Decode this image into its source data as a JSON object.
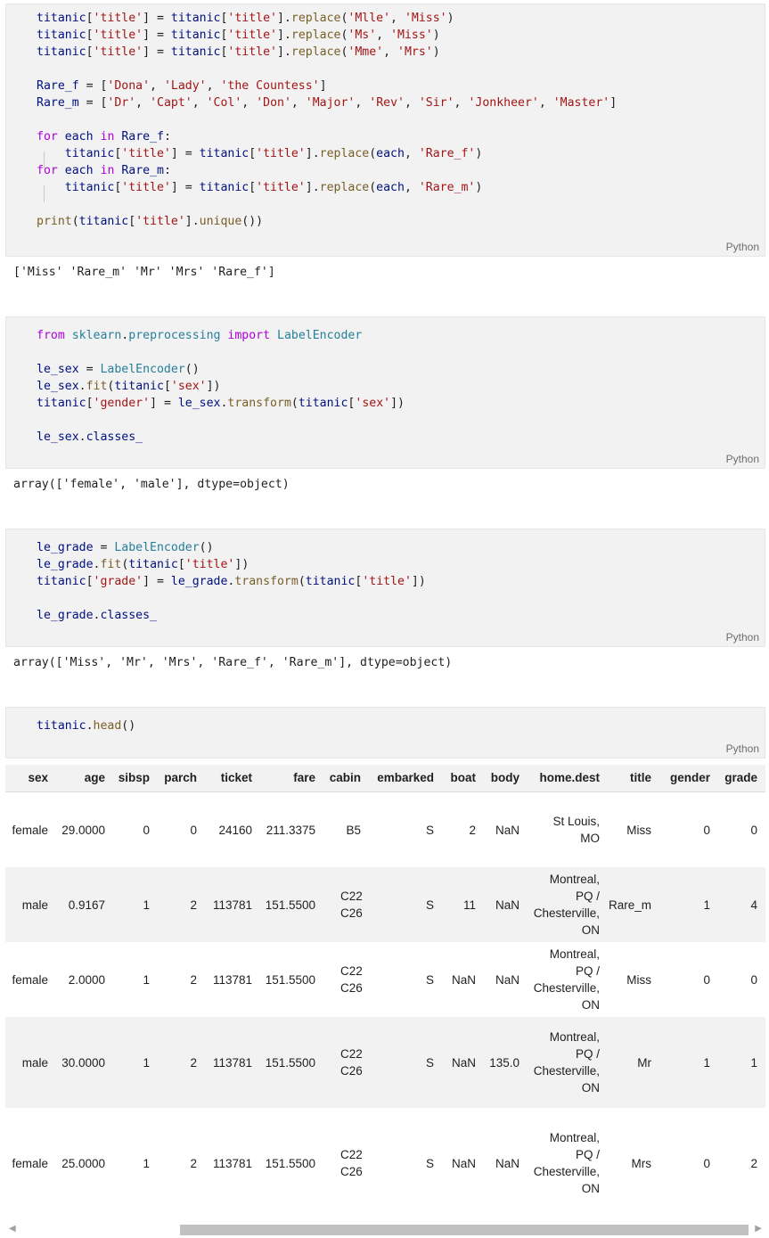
{
  "cells": [
    {
      "lang": "Python",
      "lines": [
        "titanic['title'] = titanic['title'].replace('Mlle', 'Miss')",
        "titanic['title'] = titanic['title'].replace('Ms', 'Miss')",
        "titanic['title'] = titanic['title'].replace('Mme', 'Mrs')",
        "",
        "Rare_f = ['Dona', 'Lady', 'the Countess']",
        "Rare_m = ['Dr', 'Capt', 'Col', 'Don', 'Major', 'Rev', 'Sir', 'Jonkheer', 'Master']",
        "",
        "for each in Rare_f:",
        "    titanic['title'] = titanic['title'].replace(each, 'Rare_f')",
        "for each in Rare_m:",
        "    titanic['title'] = titanic['title'].replace(each, 'Rare_m')",
        "",
        "print(titanic['title'].unique())"
      ],
      "output": "['Miss' 'Rare_m' 'Mr' 'Mrs' 'Rare_f']"
    },
    {
      "lang": "Python",
      "lines": [
        "from sklearn.preprocessing import LabelEncoder",
        "",
        "le_sex = LabelEncoder()",
        "le_sex.fit(titanic['sex'])",
        "titanic['gender'] = le_sex.transform(titanic['sex'])",
        "",
        "le_sex.classes_"
      ],
      "output": "array(['female', 'male'], dtype=object)"
    },
    {
      "lang": "Python",
      "lines": [
        "le_grade = LabelEncoder()",
        "le_grade.fit(titanic['title'])",
        "titanic['grade'] = le_grade.transform(titanic['title'])",
        "",
        "le_grade.classes_"
      ],
      "output": "array(['Miss', 'Mr', 'Mrs', 'Rare_f', 'Rare_m'], dtype=object)"
    },
    {
      "lang": "Python",
      "lines": [
        "titanic.head()"
      ],
      "output": ""
    }
  ],
  "dataframe": {
    "columns": [
      "sex",
      "age",
      "sibsp",
      "parch",
      "ticket",
      "fare",
      "cabin",
      "embarked",
      "boat",
      "body",
      "home.dest",
      "title",
      "gender",
      "grade"
    ],
    "rows": [
      [
        "female",
        "29.0000",
        "0",
        "0",
        "24160",
        "211.3375",
        "B5",
        "S",
        "2",
        "NaN",
        "St Louis, MO",
        "Miss",
        "0",
        "0"
      ],
      [
        "male",
        "0.9167",
        "1",
        "2",
        "113781",
        "151.5500",
        "C22 C26",
        "S",
        "11",
        "NaN",
        "Montreal, PQ / Chesterville, ON",
        "Rare_m",
        "1",
        "4"
      ],
      [
        "female",
        "2.0000",
        "1",
        "2",
        "113781",
        "151.5500",
        "C22 C26",
        "S",
        "NaN",
        "NaN",
        "Montreal, PQ / Chesterville, ON",
        "Miss",
        "0",
        "0"
      ],
      [
        "male",
        "30.0000",
        "1",
        "2",
        "113781",
        "151.5500",
        "C22 C26",
        "S",
        "NaN",
        "135.0",
        "Montreal, PQ / Chesterville, ON",
        "Mr",
        "1",
        "1"
      ],
      [
        "female",
        "25.0000",
        "1",
        "2",
        "113781",
        "151.5500",
        "C22 C26",
        "S",
        "NaN",
        "NaN",
        "Montreal, PQ / Chesterville, ON",
        "Mrs",
        "0",
        "2"
      ]
    ]
  },
  "icons": {
    "scroll_left": "chevron-left-icon",
    "scroll_right": "chevron-right-icon"
  }
}
